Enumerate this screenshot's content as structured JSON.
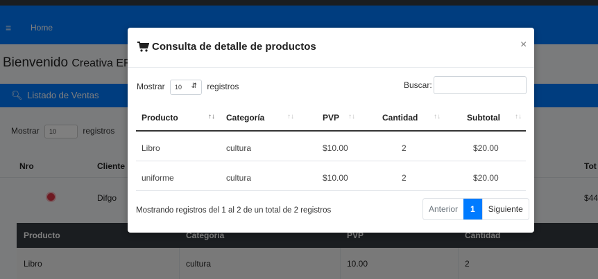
{
  "navbar": {
    "menu_icon": "≡",
    "home_label": "Home"
  },
  "welcome": {
    "text": "Bienvenido",
    "user": "Creativa EF"
  },
  "card": {
    "title": "Listado de Ventas"
  },
  "bg_list": {
    "mostrar": "Mostrar",
    "page_size": "10",
    "registros": "registros",
    "columns": {
      "nro": "Nro",
      "cliente": "Cliente",
      "total": "Tot"
    },
    "row": {
      "cliente": "Difgo",
      "total": "$44."
    }
  },
  "bg_detail": {
    "columns": [
      "Producto",
      "Categoria",
      "PVP",
      "Cantidad"
    ],
    "row": [
      "Libro",
      "cultura",
      "10.00",
      "2"
    ]
  },
  "modal": {
    "title": "Consulta de detalle de productos",
    "close": "×",
    "length_label_before": "Mostrar",
    "page_size": "10",
    "length_label_after": "registros",
    "search_label": "Buscar:",
    "search_value": "",
    "columns": [
      "Producto",
      "Categoría",
      "PVP",
      "Cantidad",
      "Subtotal"
    ],
    "rows": [
      [
        "Libro",
        "cultura",
        "$10.00",
        "2",
        "$20.00"
      ],
      [
        "uniforme",
        "cultura",
        "$10.00",
        "2",
        "$20.00"
      ]
    ],
    "info": "Mostrando registros del 1 al 2 de un total de 2 registros",
    "pagination": {
      "prev": "Anterior",
      "current": "1",
      "next": "Siguiente"
    }
  },
  "colors": {
    "primary": "#007bff",
    "dark": "#343a40",
    "danger": "#dc3545"
  }
}
